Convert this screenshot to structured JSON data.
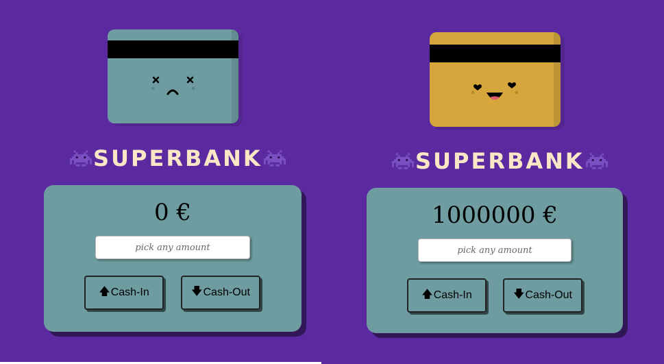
{
  "colors": {
    "background": "#5c2aa0",
    "card_empty": "#6e9ca0",
    "card_rich": "#d4a63c",
    "title": "#fbe7c6",
    "box": "#6e9ca0",
    "alien": "#7a4fc2"
  },
  "left": {
    "card_mood": "sad",
    "title": "SUPERBANK",
    "balance": "0 €",
    "amount_placeholder": "pick any amount",
    "cash_in_label": "Cash-In",
    "cash_out_label": "Cash-Out"
  },
  "right": {
    "card_mood": "happy",
    "title": "SUPERBANK",
    "balance": "1000000 €",
    "amount_placeholder": "pick any amount",
    "cash_in_label": "Cash-In",
    "cash_out_label": "Cash-Out"
  },
  "icons": {
    "alien": "alien-monster-icon",
    "cash_in": "up-arrow-icon",
    "cash_out": "down-arrow-icon"
  }
}
